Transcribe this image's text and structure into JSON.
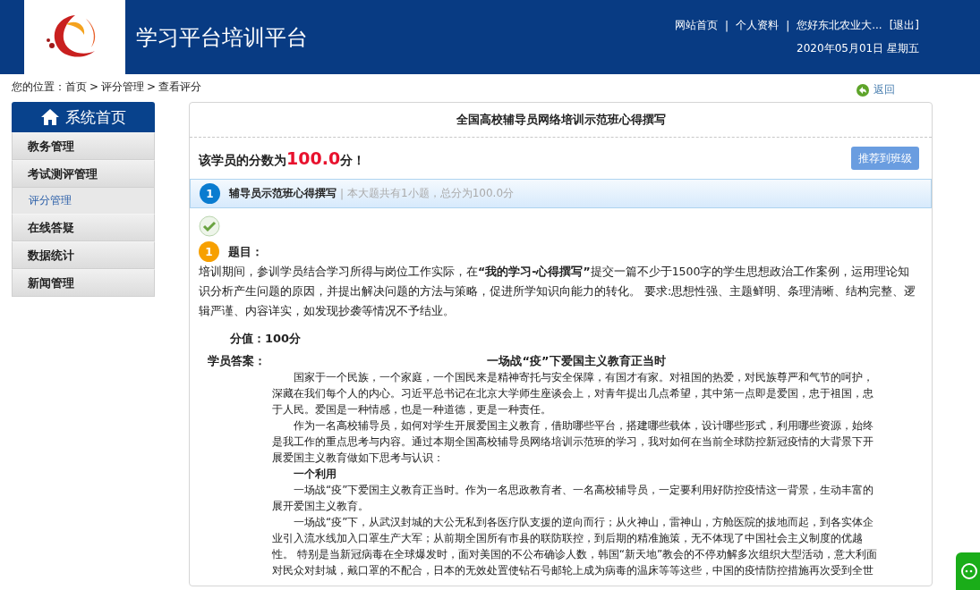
{
  "header": {
    "title": "学习平台培训平台",
    "links": [
      "网站首页",
      "个人资料",
      "您好东北农业大...",
      "[退出]"
    ],
    "separator": "|",
    "date": "2020年05月01日 星期五"
  },
  "breadcrumb": {
    "label": "您的位置：",
    "items": [
      "首页",
      "评分管理",
      "查看评分"
    ],
    "separator": ">",
    "back": "返回"
  },
  "sidebar": {
    "home": "系统首页",
    "items": [
      {
        "label": "教务管理"
      },
      {
        "label": "考试测评管理",
        "children": [
          {
            "label": "评分管理"
          }
        ]
      },
      {
        "label": "在线答疑"
      },
      {
        "label": "数据统计"
      },
      {
        "label": "新闻管理"
      }
    ]
  },
  "panel": {
    "title": "全国高校辅导员网络培训示范班心得撰写",
    "score_prefix": "该学员的分数为",
    "score": "100.0",
    "score_suffix": "分！",
    "recommend_button": "推荐到班级",
    "section": {
      "number": "1",
      "name": "辅导员示范班心得撰写",
      "separator": "|",
      "info": "本大题共有1小题，总分为100.0分"
    },
    "question": {
      "correct": true,
      "number": "1",
      "label": "题目：",
      "text": "培训期间，参训学员结合学习所得与岗位工作实际，在**“我的学习-心得撰写”**提交一篇不少于1500字的学生思想政治工作案例，运用理论知识分析产生问题的原因，并提出解决问题的方法与策略，促进所学知识向能力的转化。 要求:思想性强、主题鲜明、条理清晰、结构完整、逻辑严谨、内容详实，如发现抄袭等情况不予结业。",
      "points": "分值：100分",
      "answer_label": "学员答案：",
      "answer_title": "一场战“疫”下爱国主义教育正当时",
      "answer": [
        {
          "kind": "paragraph",
          "lines": [
            "国家于一个民族，一个家庭，一个国民来是精神寄托与安全保障，有国才有家。对祖国的热爱，对民族尊严和气节的呵护，",
            "深藏在我们每个人的内心。习近平总书记在北京大学师生座谈会上，对青年提出几点希望，其中第一点即是爱国，忠于祖国，忠",
            "于人民。爱国是一种情感，也是一种道德，更是一种责任。"
          ]
        },
        {
          "kind": "paragraph",
          "lines": [
            "作为一名高校辅导员，如何对学生开展爱国主义教育，借助哪些平台，搭建哪些载体，设计哪些形式，利用哪些资源，始终",
            "是我工作的重点思考与内容。通过本期全国高校辅导员网络培训示范班的学习，我对如何在当前全球防控新冠疫情的大背景下开",
            "展爱国主义教育做如下思考与认识："
          ]
        },
        {
          "kind": "heading",
          "lines": [
            "一个利用"
          ]
        },
        {
          "kind": "paragraph",
          "lines": [
            "一场战“疫”下爱国主义教育正当时。作为一名思政教育者、一名高校辅导员，一定要利用好防控疫情这一背景，生动丰富的",
            "展开爱国主义教育。"
          ]
        },
        {
          "kind": "paragraph",
          "lines": [
            "一场战“疫”下，从武汉封城的大公无私到各医疗队支援的逆向而行；从火神山，雷神山，方舱医院的拔地而起，到各实体企",
            "业引入流水线加入口罩生产大军；从前期全国所有市县的联防联控，到后期的精准施策，无不体现了中国社会主义制度的优越",
            "性。 特别是当新冠病毒在全球爆发时，面对美国的不公布确诊人数，韩国“新天地”教会的不停劝解多次组织大型活动，意大利面",
            "对民众对封城，戴口罩的不配合，日本的无效处置使钻石号邮轮上成为病毒的温床等等这些，中国的疫情防控措施再次受到全世"
          ]
        }
      ]
    }
  }
}
